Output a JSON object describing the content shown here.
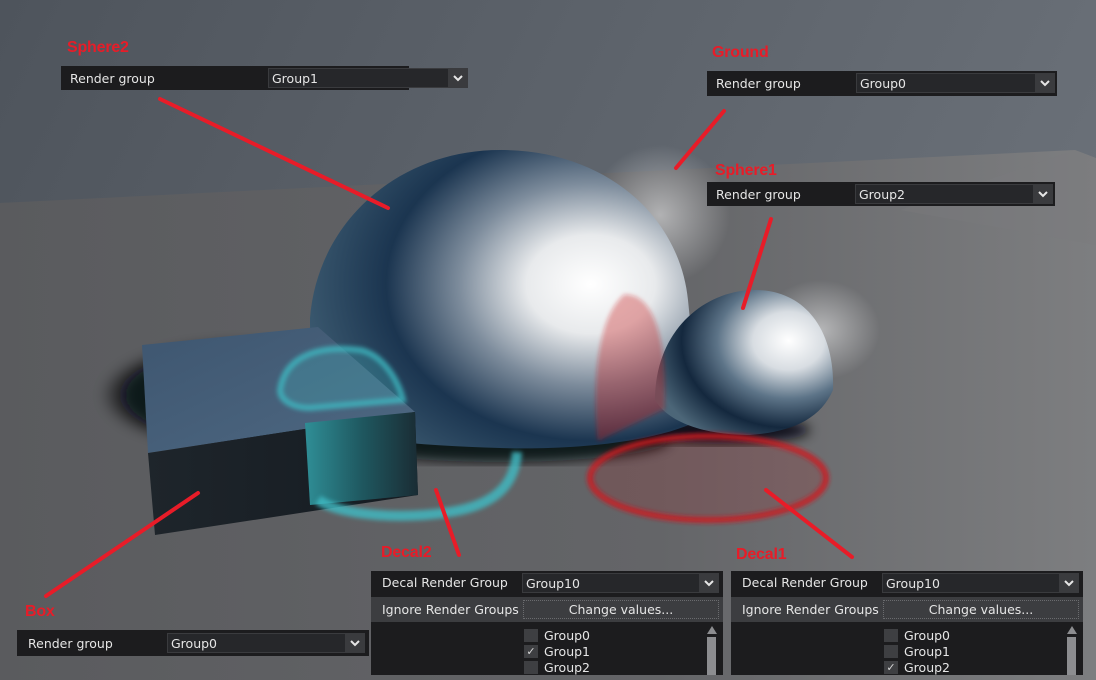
{
  "scene": {
    "colors": {
      "sky": "#555b63",
      "ground": "#636466",
      "sphere_dark": "#14273d",
      "sphere_light": "#ffffff",
      "box_top": "#46607a",
      "box_side": "#1c2228",
      "decal2_color": "#3fbcc4",
      "decal1_color": "#cc1a1e",
      "annotation": "#e81c28"
    }
  },
  "annotations": {
    "sphere2": {
      "label": "Sphere2",
      "field_label": "Render group",
      "value": "Group1"
    },
    "ground": {
      "label": "Ground",
      "field_label": "Render group",
      "value": "Group0"
    },
    "sphere1": {
      "label": "Sphere1",
      "field_label": "Render group",
      "value": "Group2"
    },
    "box": {
      "label": "Box",
      "field_label": "Render group",
      "value": "Group0"
    },
    "decal2": {
      "label": "Decal2",
      "render_group_label": "Decal Render Group",
      "render_group_value": "Group10",
      "ignore_label": "Ignore Render Groups",
      "change_button": "Change values...",
      "groups": [
        {
          "name": "Group0",
          "checked": false
        },
        {
          "name": "Group1",
          "checked": true
        },
        {
          "name": "Group2",
          "checked": false
        }
      ]
    },
    "decal1": {
      "label": "Decal1",
      "render_group_label": "Decal Render Group",
      "render_group_value": "Group10",
      "ignore_label": "Ignore Render Groups",
      "change_button": "Change values...",
      "groups": [
        {
          "name": "Group0",
          "checked": false
        },
        {
          "name": "Group1",
          "checked": false
        },
        {
          "name": "Group2",
          "checked": true
        }
      ]
    }
  },
  "icons": {
    "dropdown": "chevron-down-icon",
    "check": "✓",
    "scroll_up": "triangle-up-icon"
  }
}
